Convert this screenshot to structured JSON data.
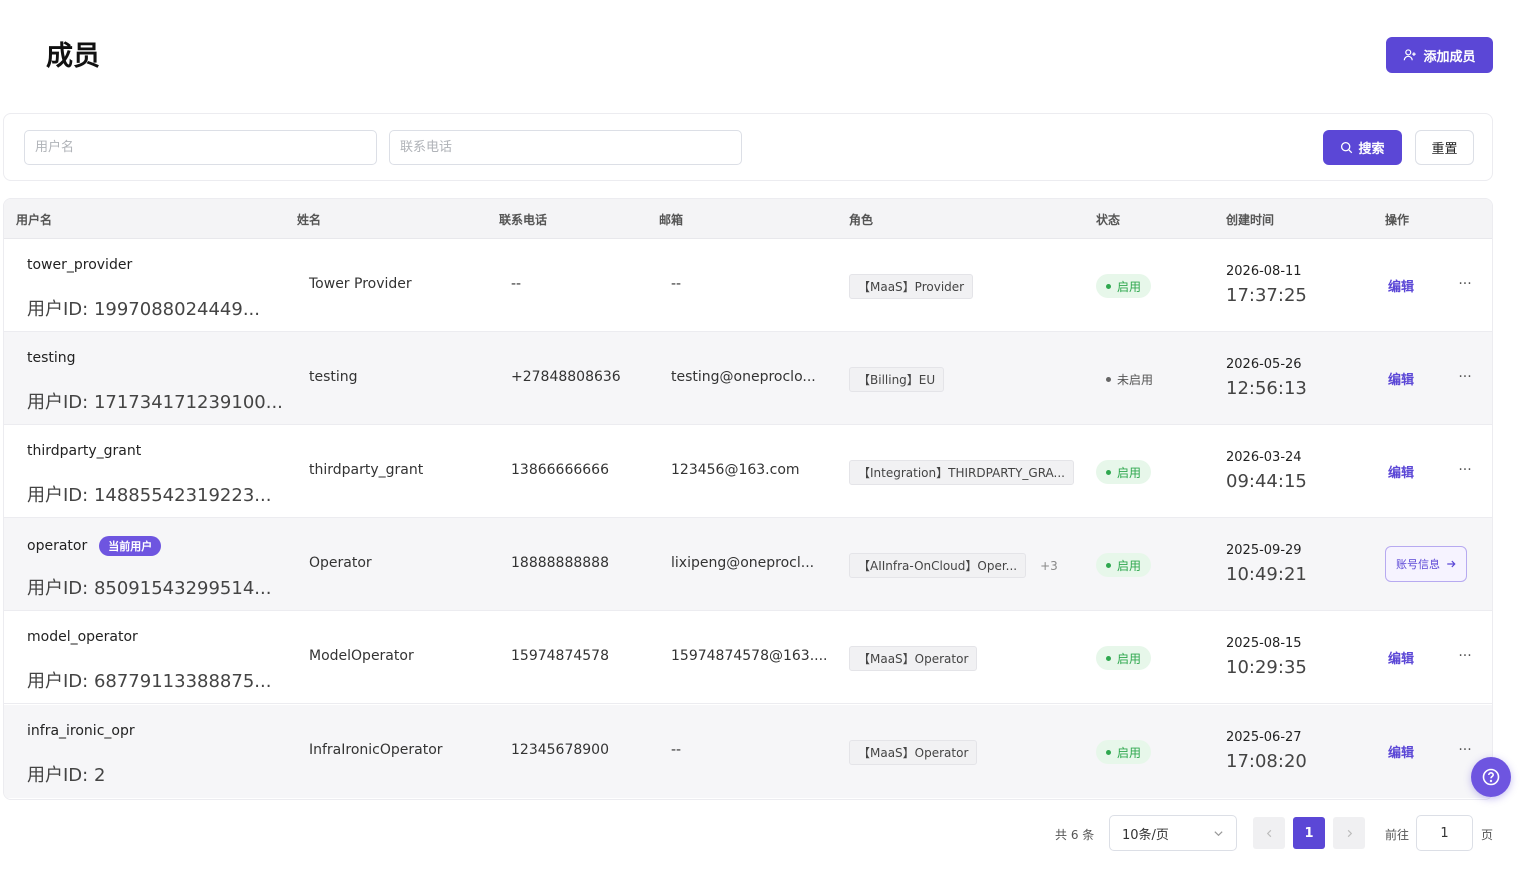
{
  "header": {
    "title": "成员",
    "add_button_label": "添加成员"
  },
  "search": {
    "username_placeholder": "用户名",
    "phone_placeholder": "联系电话",
    "search_label": "搜索",
    "reset_label": "重置"
  },
  "table": {
    "columns": [
      "用户名",
      "姓名",
      "联系电话",
      "邮箱",
      "角色",
      "状态",
      "创建时间",
      "操作"
    ],
    "rows": [
      {
        "username": "tower_provider",
        "user_id": "用户ID: 1997088024449...",
        "name": "Tower Provider",
        "phone": "--",
        "email": "--",
        "role": "【MaaS】Provider",
        "role_more": "",
        "status": "启用",
        "date": "2026-08-11",
        "time": "17:37:25",
        "action": "编辑"
      },
      {
        "username": "testing",
        "user_id": "用户ID: 171734171239100...",
        "name": "testing",
        "phone": "+27848808636",
        "email": "testing@oneproclo...",
        "role": "【Billing】EU",
        "role_more": "",
        "status": "未启用",
        "date": "2026-05-26",
        "time": "12:56:13",
        "action": "编辑"
      },
      {
        "username": "thirdparty_grant",
        "user_id": "用户ID: 14885542319223...",
        "name": "thirdparty_grant",
        "phone": "13866666666",
        "email": "123456@163.com",
        "role": "【Integration】THIRDPARTY_GRA...",
        "role_more": "",
        "status": "启用",
        "date": "2026-03-24",
        "time": "09:44:15",
        "action": "编辑"
      },
      {
        "username": "operator",
        "current_badge": "当前用户",
        "user_id": "用户ID: 85091543299514...",
        "name": "Operator",
        "phone": "18888888888",
        "email": "lixipeng@oneprocl...",
        "role": "【AIInfra-OnCloud】Oper...",
        "role_more": "+3",
        "status": "启用",
        "date": "2025-09-29",
        "time": "10:49:21",
        "action": "账号信息"
      },
      {
        "username": "model_operator",
        "user_id": "用户ID: 68779113388875...",
        "name": "ModelOperator",
        "phone": "15974874578",
        "email": "15974874578@163....",
        "role": "【MaaS】Operator",
        "role_more": "",
        "status": "启用",
        "date": "2025-08-15",
        "time": "10:29:35",
        "action": "编辑"
      },
      {
        "username": "infra_ironic_opr",
        "user_id": "用户ID: 2",
        "name": "InfraIronicOperator",
        "phone": "12345678900",
        "email": "--",
        "role": "【MaaS】Operator",
        "role_more": "",
        "status": "启用",
        "date": "2025-06-27",
        "time": "17:08:20",
        "action": "编辑"
      }
    ]
  },
  "pagination": {
    "total": "共 6 条",
    "page_size": "10条/页",
    "current_page": "1",
    "goto_label": "前往",
    "goto_value": "1",
    "page_suffix": "页"
  },
  "colors": {
    "accent": "#5b47d6",
    "status_on": "#2fa84f"
  }
}
